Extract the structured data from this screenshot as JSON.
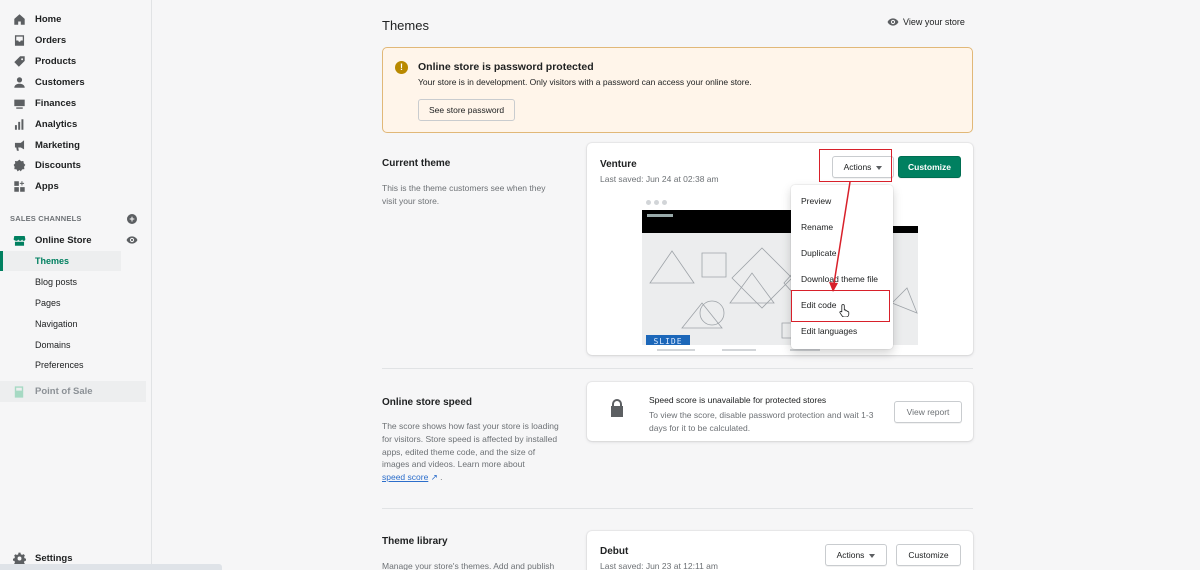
{
  "sidebar": {
    "nav": [
      {
        "label": "Home",
        "icon": "home-icon"
      },
      {
        "label": "Orders",
        "icon": "orders-icon"
      },
      {
        "label": "Products",
        "icon": "products-icon"
      },
      {
        "label": "Customers",
        "icon": "customers-icon"
      },
      {
        "label": "Finances",
        "icon": "finances-icon"
      },
      {
        "label": "Analytics",
        "icon": "analytics-icon"
      },
      {
        "label": "Marketing",
        "icon": "marketing-icon"
      },
      {
        "label": "Discounts",
        "icon": "discounts-icon"
      },
      {
        "label": "Apps",
        "icon": "apps-icon"
      }
    ],
    "channels_label": "SALES CHANNELS",
    "online_store": "Online Store",
    "sub_items": [
      "Themes",
      "Blog posts",
      "Pages",
      "Navigation",
      "Domains",
      "Preferences"
    ],
    "point_of_sale": "Point of Sale",
    "settings": "Settings"
  },
  "header": {
    "title": "Themes",
    "view_store": "View your store"
  },
  "banner": {
    "title": "Online store is password protected",
    "text": "Your store is in development. Only visitors with a password can access your online store.",
    "button": "See store password"
  },
  "current_theme": {
    "title": "Current theme",
    "description": "This is the theme customers see when they visit your store.",
    "theme_name": "Venture",
    "last_saved": "Last saved: Jun 24 at 02:38 am",
    "actions_button": "Actions",
    "customize_button": "Customize",
    "preview_banner_text": "SLIDE"
  },
  "actions_menu": {
    "items": [
      "Preview",
      "Rename",
      "Duplicate",
      "Download theme file",
      "Edit code",
      "Edit languages"
    ]
  },
  "store_speed": {
    "title": "Online store speed",
    "description": "The score shows how fast your store is loading for visitors. Store speed is affected by installed apps, edited theme code, and the size of images and videos. Learn more about",
    "link": "speed score",
    "link_suffix": " .",
    "card_title": "Speed score is unavailable for protected stores",
    "card_text": "To view the score, disable password protection and wait 1-3 days for it to be calculated.",
    "view_report": "View report"
  },
  "theme_library": {
    "title": "Theme library",
    "description": "Manage your store's themes. Add and publish",
    "theme_name": "Debut",
    "last_saved": "Last saved: Jun 23 at 12:11 am",
    "actions_button": "Actions",
    "customize_button": "Customize"
  },
  "colors": {
    "accent": "#008060",
    "highlight": "#d8202a",
    "banner_bg": "#fff5ea"
  }
}
